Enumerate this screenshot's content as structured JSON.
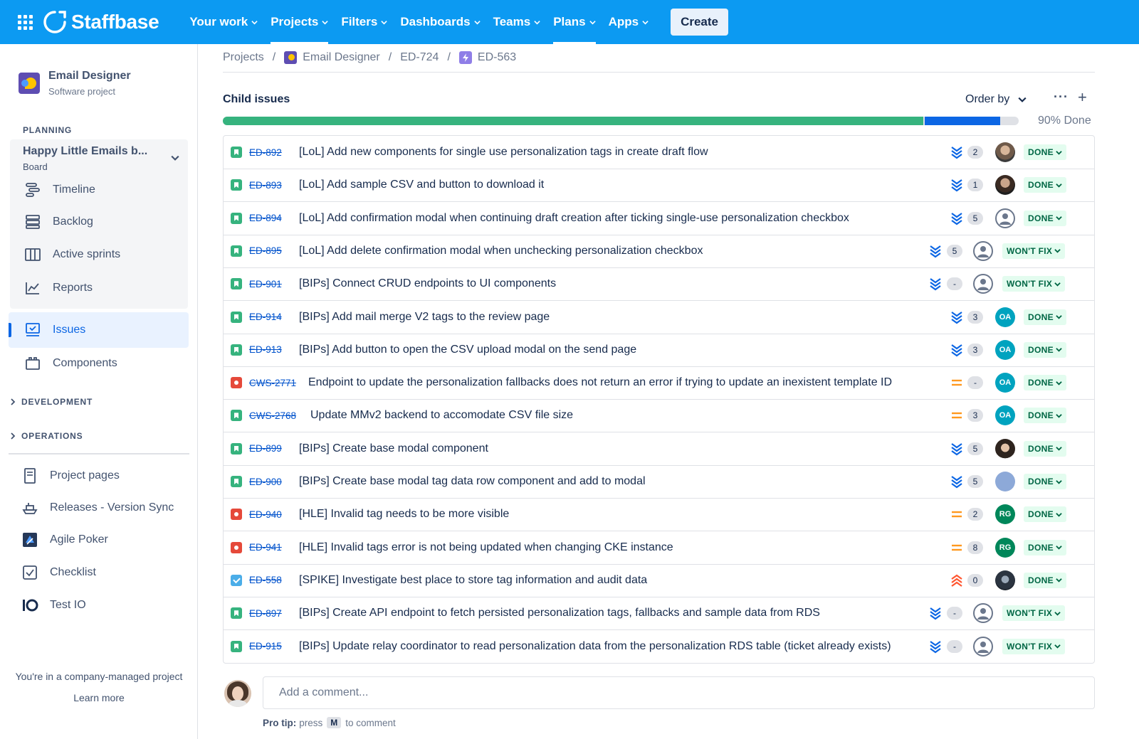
{
  "topnav": {
    "brand": "Staffbase",
    "items": [
      {
        "label": "Your work"
      },
      {
        "label": "Projects"
      },
      {
        "label": "Filters"
      },
      {
        "label": "Dashboards"
      },
      {
        "label": "Teams"
      },
      {
        "label": "Plans"
      },
      {
        "label": "Apps"
      }
    ],
    "create_label": "Create",
    "colors": {
      "bar": "#0c9af2"
    }
  },
  "sidebar": {
    "project_name": "Email Designer",
    "project_type": "Software project",
    "planning_label": "PLANNING",
    "board_name": "Happy Little Emails b...",
    "board_sub": "Board",
    "planning_items": [
      {
        "label": "Timeline",
        "icon": "timeline-icon"
      },
      {
        "label": "Backlog",
        "icon": "backlog-icon"
      },
      {
        "label": "Active sprints",
        "icon": "active-sprints-icon"
      },
      {
        "label": "Reports",
        "icon": "reports-icon"
      }
    ],
    "issues_label": "Issues",
    "components_label": "Components",
    "development_label": "DEVELOPMENT",
    "operations_label": "OPERATIONS",
    "bottom_items": [
      {
        "label": "Project pages"
      },
      {
        "label": "Releases - Version Sync"
      },
      {
        "label": "Agile Poker"
      },
      {
        "label": "Checklist"
      },
      {
        "label": "Test IO"
      }
    ],
    "footer_note": "You're in a company-managed project",
    "learn_more": "Learn more"
  },
  "breadcrumb": {
    "projects": "Projects",
    "project": "Email Designer",
    "parent": "ED-724",
    "current": "ED-563"
  },
  "child_issues": {
    "title": "Child issues",
    "order_by": "Order by",
    "progress_done_fraction": 0.88,
    "progress_inprogress_fraction": 0.095,
    "progress_label": "90% Done",
    "rows": [
      {
        "type": "story",
        "key": "ED-892",
        "summary": "[LoL] Add new components for single use personalization tags in create draft flow",
        "priority": "lowest",
        "points": "2",
        "assignee": "photo-a",
        "status": "DONE"
      },
      {
        "type": "story",
        "key": "ED-893",
        "summary": "[LoL] Add sample CSV and button to download it",
        "priority": "lowest",
        "points": "1",
        "assignee": "photo-b",
        "status": "DONE"
      },
      {
        "type": "story",
        "key": "ED-894",
        "summary": "[LoL] Add confirmation modal when continuing draft creation after ticking single-use personalization checkbox",
        "priority": "lowest",
        "points": "5",
        "assignee": "unassigned",
        "status": "DONE"
      },
      {
        "type": "story",
        "key": "ED-895",
        "summary": "[LoL] Add delete confirmation modal when unchecking personalization checkbox",
        "priority": "lowest",
        "points": "5",
        "assignee": "unassigned",
        "status": "WON'T FIX"
      },
      {
        "type": "story",
        "key": "ED-901",
        "summary": "[BIPs] Connect CRUD endpoints to UI components",
        "priority": "lowest",
        "points": "-",
        "assignee": "unassigned",
        "status": "WON'T FIX"
      },
      {
        "type": "story",
        "key": "ED-914",
        "summary": "[BIPs] Add mail merge V2 tags to the review page",
        "priority": "lowest",
        "points": "3",
        "assignee": "OA",
        "status": "DONE"
      },
      {
        "type": "story",
        "key": "ED-913",
        "summary": "[BIPs] Add button to open the CSV upload modal on the send page",
        "priority": "lowest",
        "points": "3",
        "assignee": "OA",
        "status": "DONE"
      },
      {
        "type": "bug",
        "key": "CWS-2771",
        "summary": "Endpoint to update the personalization fallbacks does not return an error if trying to update an inexistent template ID",
        "priority": "medium",
        "points": "-",
        "assignee": "OA",
        "status": "DONE"
      },
      {
        "type": "story",
        "key": "CWS-2768",
        "summary": "Update MMv2 backend to accomodate CSV file size",
        "priority": "medium",
        "points": "3",
        "assignee": "OA",
        "status": "DONE"
      },
      {
        "type": "story",
        "key": "ED-899",
        "summary": "[BIPs] Create base modal component",
        "priority": "lowest",
        "points": "5",
        "assignee": "photo-c",
        "status": "DONE"
      },
      {
        "type": "story",
        "key": "ED-900",
        "summary": "[BIPs] Create base modal tag data row component and add to modal",
        "priority": "lowest",
        "points": "5",
        "assignee": "photo-d",
        "status": "DONE"
      },
      {
        "type": "bug",
        "key": "ED-940",
        "summary": "[HLE] Invalid tag needs to be more visible",
        "priority": "medium",
        "points": "2",
        "assignee": "RG",
        "status": "DONE"
      },
      {
        "type": "bug",
        "key": "ED-941",
        "summary": "[HLE] Invalid tags error is not being updated when changing CKE instance",
        "priority": "medium",
        "points": "8",
        "assignee": "RG",
        "status": "DONE"
      },
      {
        "type": "task",
        "key": "ED-558",
        "summary": "[SPIKE] Investigate best place to store tag information and audit data",
        "priority": "highest",
        "points": "0",
        "assignee": "photo-e",
        "status": "DONE"
      },
      {
        "type": "story",
        "key": "ED-897",
        "summary": "[BIPs] Create API endpoint to fetch persisted personalization tags, fallbacks and sample data from RDS",
        "priority": "lowest",
        "points": "-",
        "assignee": "unassigned",
        "status": "WON'T FIX"
      },
      {
        "type": "story",
        "key": "ED-915",
        "summary": "[BIPs] Update relay coordinator to read personalization data from the personalization RDS table (ticket already exists)",
        "priority": "lowest",
        "points": "-",
        "assignee": "unassigned",
        "status": "WON'T FIX"
      }
    ]
  },
  "comment": {
    "placeholder": "Add a comment...",
    "pro_tip_label": "Pro tip:",
    "pro_tip_press": "press",
    "pro_tip_key": "M",
    "pro_tip_rest": "to comment"
  }
}
